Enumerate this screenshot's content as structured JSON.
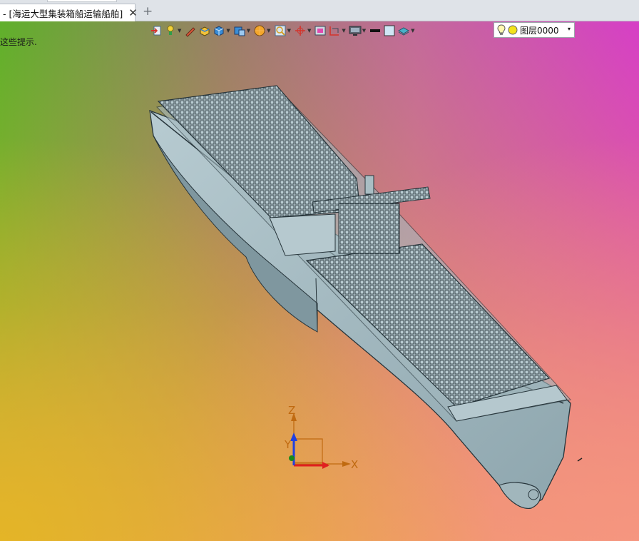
{
  "tab": {
    "title": "- [海运大型集装箱船运输船舶]",
    "close_glyph": "✕",
    "new_tab_glyph": "+"
  },
  "toolbar": {
    "items": [
      {
        "name": "exit-icon",
        "caret": false
      },
      {
        "name": "light-icon",
        "caret": true
      },
      {
        "name": "pen-icon",
        "caret": false
      },
      {
        "name": "box-color-icon",
        "caret": false
      },
      {
        "name": "cube-icon",
        "caret": true
      },
      {
        "name": "view-cube-icon",
        "caret": true
      },
      {
        "name": "render-icon",
        "caret": true
      },
      {
        "name": "zoom-icon",
        "caret": true
      },
      {
        "name": "axis-icon",
        "caret": true
      },
      {
        "name": "frame-icon",
        "caret": false
      },
      {
        "name": "section-icon",
        "caret": true
      },
      {
        "name": "display-icon",
        "caret": true
      },
      {
        "name": "line-weight-icon",
        "caret": false
      },
      {
        "name": "color-swatch-icon",
        "caret": false
      },
      {
        "name": "layer-stack-icon",
        "caret": true
      }
    ]
  },
  "layer": {
    "label": "图层0000",
    "caret_glyph": "▾"
  },
  "hint": {
    "text": "这些提示."
  },
  "triad": {
    "x_label": "X",
    "y_label": "Y",
    "z_label": "Z"
  },
  "colors": {
    "hull": "#a9bfc6",
    "hull_dark": "#7f979f",
    "container": "#b8ccd2",
    "axis_x": "#e02020",
    "axis_y": "#1a8a1a",
    "axis_z": "#2040e0"
  }
}
